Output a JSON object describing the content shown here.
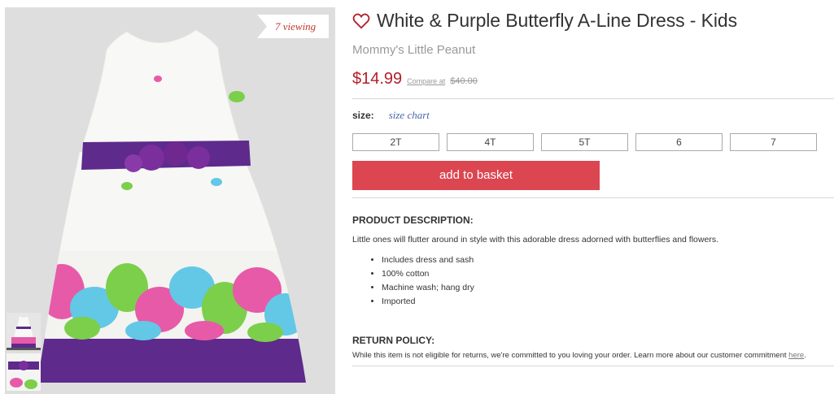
{
  "gallery": {
    "viewing_badge": "7 viewing",
    "main_image_alt": "White and purple butterfly A-line dress",
    "thumbnails": [
      "dress-front",
      "dress-sash-detail"
    ]
  },
  "product": {
    "title": "White & Purple Butterfly A-Line Dress - Kids",
    "brand": "Mommy's Little Peanut",
    "price": "$14.99",
    "compare_label": "Compare at",
    "compare_price": "$40.00"
  },
  "size": {
    "label": "size:",
    "chart_link": "size chart",
    "options": [
      "2T",
      "4T",
      "5T",
      "6",
      "7"
    ]
  },
  "basket_button": "add to basket",
  "description": {
    "heading": "PRODUCT DESCRIPTION:",
    "text": "Little ones will flutter around in style with this adorable dress adorned with butterflies and flowers.",
    "bullets": [
      "Includes dress and sash",
      "100% cotton",
      "Machine wash; hang dry",
      "Imported"
    ]
  },
  "return_policy": {
    "heading": "RETURN POLICY:",
    "text": "While this item is not eligible for returns, we're committed to you loving your order. Learn more about our customer commitment",
    "link": "here",
    "suffix": "."
  },
  "colors": {
    "price_red": "#b3202a",
    "button_red": "#dc4651",
    "dress_purple": "#5e2a8c",
    "link_blue": "#4a66a8"
  }
}
